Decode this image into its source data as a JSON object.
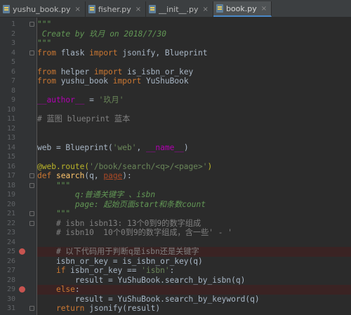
{
  "tabs": [
    {
      "label": "yushu_book.py",
      "active": false
    },
    {
      "label": "fisher.py",
      "active": false
    },
    {
      "label": "__init__.py",
      "active": false
    },
    {
      "label": "book.py",
      "active": true
    }
  ],
  "close_glyph": "×",
  "colors": {
    "background": "#2b2b2b",
    "gutter": "#313335",
    "keyword": "#cc7832",
    "string": "#6a8759",
    "comment": "#808080",
    "decorator": "#bbb529",
    "breakpoint": "#c75450",
    "active_tab_underline": "#4a88c7"
  },
  "editor": {
    "breakpoint_lines": [
      25,
      29
    ],
    "lines": [
      {
        "n": "1",
        "code": [
          [
            "doc",
            "\"\"\""
          ]
        ]
      },
      {
        "n": "2",
        "code": [
          [
            "doc",
            " Create by 玖月 on 2018/7/30"
          ]
        ]
      },
      {
        "n": "3",
        "code": [
          [
            "doc",
            "\"\"\""
          ]
        ]
      },
      {
        "n": "4",
        "code": [
          [
            "kw",
            "from"
          ],
          [
            "txt",
            " flask "
          ],
          [
            "kw",
            "import"
          ],
          [
            "txt",
            " jsonify, Blueprint"
          ]
        ]
      },
      {
        "n": "5",
        "code": []
      },
      {
        "n": "6",
        "code": [
          [
            "kw",
            "from"
          ],
          [
            "txt",
            " helper "
          ],
          [
            "kw",
            "import"
          ],
          [
            "txt",
            " is_isbn_or_key"
          ]
        ]
      },
      {
        "n": "7",
        "code": [
          [
            "kw",
            "from"
          ],
          [
            "txt",
            " yushu_book "
          ],
          [
            "kw",
            "import"
          ],
          [
            "txt",
            " YuShuBook"
          ]
        ]
      },
      {
        "n": "8",
        "code": []
      },
      {
        "n": "9",
        "code": [
          [
            "dunder",
            "__author__"
          ],
          [
            "txt",
            " = "
          ],
          [
            "str",
            "'玖月'"
          ]
        ]
      },
      {
        "n": "10",
        "code": []
      },
      {
        "n": "11",
        "code": [
          [
            "cmt",
            "# 蓝图 blueprint 蓝本"
          ]
        ]
      },
      {
        "n": "12",
        "code": []
      },
      {
        "n": "13",
        "code": []
      },
      {
        "n": "14",
        "code": [
          [
            "txt",
            "web = Blueprint("
          ],
          [
            "str",
            "'web'"
          ],
          [
            "txt",
            ", "
          ],
          [
            "dunder",
            "__name__"
          ],
          [
            "txt",
            ")"
          ]
        ]
      },
      {
        "n": "15",
        "code": []
      },
      {
        "n": "16",
        "code": [
          [
            "dec",
            "@web.route("
          ],
          [
            "str",
            "'/book/search/<q>/<page>'"
          ],
          [
            "dec",
            ")"
          ]
        ]
      },
      {
        "n": "17",
        "code": [
          [
            "kw",
            "def"
          ],
          [
            "txt",
            " "
          ],
          [
            "fn",
            "search"
          ],
          [
            "txt",
            "(q, "
          ],
          [
            "param",
            "page"
          ],
          [
            "txt",
            "):"
          ]
        ]
      },
      {
        "n": "18",
        "code": [
          [
            "doc",
            "    \"\"\""
          ]
        ]
      },
      {
        "n": "19",
        "code": [
          [
            "doc",
            "        q:普通关键字 、isbn"
          ]
        ]
      },
      {
        "n": "20",
        "code": [
          [
            "doc",
            "        page: 起始页面start和条数count"
          ]
        ]
      },
      {
        "n": "21",
        "code": [
          [
            "doc",
            "    \"\"\""
          ]
        ]
      },
      {
        "n": "22",
        "code": [
          [
            "cmt",
            "    # isbn isbn13: 13个0到9的数字组成"
          ]
        ]
      },
      {
        "n": "23",
        "code": [
          [
            "cmt",
            "    # isbn10  10个0到9的数字组成，含一些' - '"
          ]
        ]
      },
      {
        "n": "24",
        "code": []
      },
      {
        "n": "25",
        "code": [
          [
            "cmt",
            "    # 以下代码用于判断q是isbn还是关键字"
          ]
        ]
      },
      {
        "n": "26",
        "code": [
          [
            "txt",
            "    isbn_or_key = is_isbn_or_key(q)"
          ]
        ]
      },
      {
        "n": "27",
        "code": [
          [
            "txt",
            "    "
          ],
          [
            "kw",
            "if"
          ],
          [
            "txt",
            " isbn_or_key == "
          ],
          [
            "str",
            "'isbn'"
          ],
          [
            "txt",
            ":"
          ]
        ]
      },
      {
        "n": "28",
        "code": [
          [
            "txt",
            "        result = YuShuBook.search_by_isbn(q)"
          ]
        ]
      },
      {
        "n": "29",
        "code": [
          [
            "txt",
            "    "
          ],
          [
            "kw",
            "else"
          ],
          [
            "txt",
            ":"
          ]
        ]
      },
      {
        "n": "30",
        "code": [
          [
            "txt",
            "        result = YuShuBook.search_by_keyword(q)"
          ]
        ]
      },
      {
        "n": "31",
        "code": [
          [
            "txt",
            "    "
          ],
          [
            "kw",
            "return"
          ],
          [
            "txt",
            " jsonify(result)"
          ]
        ]
      }
    ]
  }
}
